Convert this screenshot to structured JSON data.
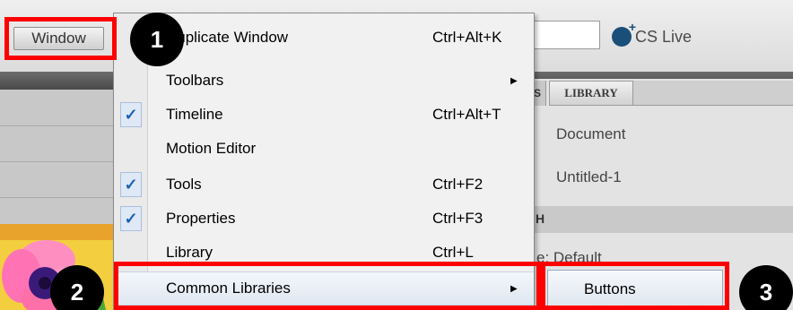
{
  "toolbar": {
    "window_button_label": "Window",
    "cs_live_label": "CS Live"
  },
  "menu": {
    "items": [
      {
        "label": "Duplicate Window",
        "shortcut": "Ctrl+Alt+K",
        "checked": false,
        "submenu": false
      },
      {
        "label": "Toolbars",
        "shortcut": "",
        "checked": false,
        "submenu": true
      },
      {
        "label": "Timeline",
        "shortcut": "Ctrl+Alt+T",
        "checked": true,
        "submenu": false
      },
      {
        "label": "Motion Editor",
        "shortcut": "",
        "checked": false,
        "submenu": false
      },
      {
        "label": "Tools",
        "shortcut": "Ctrl+F2",
        "checked": true,
        "submenu": false
      },
      {
        "label": "Properties",
        "shortcut": "Ctrl+F3",
        "checked": true,
        "submenu": false
      },
      {
        "label": "Library",
        "shortcut": "Ctrl+L",
        "checked": false,
        "submenu": false
      },
      {
        "label": "Common Libraries",
        "shortcut": "",
        "checked": false,
        "submenu": true
      }
    ],
    "check_glyph": "✓",
    "arrow_glyph": "▶"
  },
  "submenu": {
    "items": [
      {
        "label": "Buttons"
      }
    ]
  },
  "right_panel": {
    "tab_partial": "S",
    "tab_library": "LIBRARY",
    "document_label": "Document",
    "untitled_label": "Untitled-1",
    "band_label": "H",
    "default_label": "e: Default"
  },
  "callouts": {
    "badges": [
      "1",
      "2",
      "3"
    ],
    "color": "#ff0000"
  }
}
